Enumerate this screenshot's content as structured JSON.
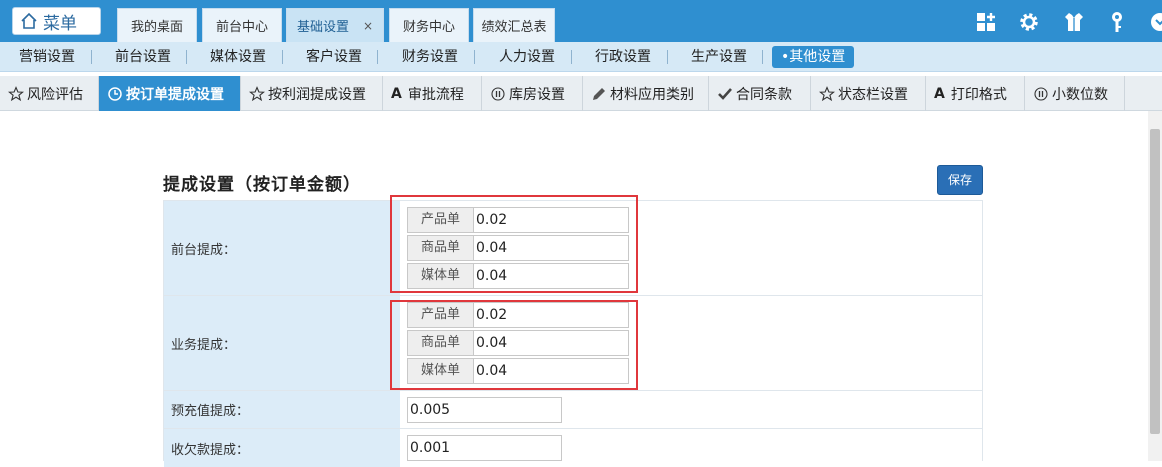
{
  "top": {
    "menu_label": "菜单",
    "tabs": [
      {
        "label": "我的桌面"
      },
      {
        "label": "前台中心"
      },
      {
        "label": "基础设置",
        "close": "×"
      },
      {
        "label": "财务中心"
      },
      {
        "label": "绩效汇总表"
      }
    ],
    "icons": [
      "grid-plus-icon",
      "gear-icon",
      "shirt-icon",
      "key-icon",
      "signout-icon"
    ]
  },
  "nav2": {
    "items": [
      "营销设置",
      "前台设置",
      "媒体设置",
      "客户设置",
      "财务设置",
      "人力设置",
      "行政设置",
      "生产设置",
      "•其他设置"
    ],
    "active_index": 8
  },
  "nav3": {
    "items": [
      {
        "label": "风险评估",
        "icon": "star-icon"
      },
      {
        "label": "按订单提成设置",
        "icon": "clock-icon"
      },
      {
        "label": "按利润提成设置",
        "icon": "star-icon"
      },
      {
        "label": "审批流程",
        "glyph": "A"
      },
      {
        "label": "库房设置",
        "icon": "pause-circle-icon"
      },
      {
        "label": "材料应用类别",
        "icon": "pencil-icon"
      },
      {
        "label": "合同条款",
        "icon": "check-icon"
      },
      {
        "label": "状态栏设置",
        "icon": "star-icon"
      },
      {
        "label": "打印格式",
        "glyph": "A"
      },
      {
        "label": "小数位数",
        "icon": "pause-circle-icon"
      }
    ],
    "active_index": 1
  },
  "content": {
    "title": "提成设置（按订单金额）",
    "save_label": "保存",
    "rows": [
      {
        "label": "前台提成：",
        "groups": [
          {
            "label": "产品单",
            "value": "0.02"
          },
          {
            "label": "商品单",
            "value": "0.04"
          },
          {
            "label": "媒体单",
            "value": "0.04"
          }
        ]
      },
      {
        "label": "业务提成：",
        "groups": [
          {
            "label": "产品单",
            "value": "0.02"
          },
          {
            "label": "商品单",
            "value": "0.04"
          },
          {
            "label": "媒体单",
            "value": "0.04"
          }
        ]
      },
      {
        "label": "预充值提成：",
        "value": "0.005"
      },
      {
        "label": "收欠款提成：",
        "value": "0.001"
      }
    ]
  },
  "colors": {
    "accent": "#2f8fd0",
    "highlight_box": "#e0373c",
    "label_bg": "#dcecf8"
  }
}
